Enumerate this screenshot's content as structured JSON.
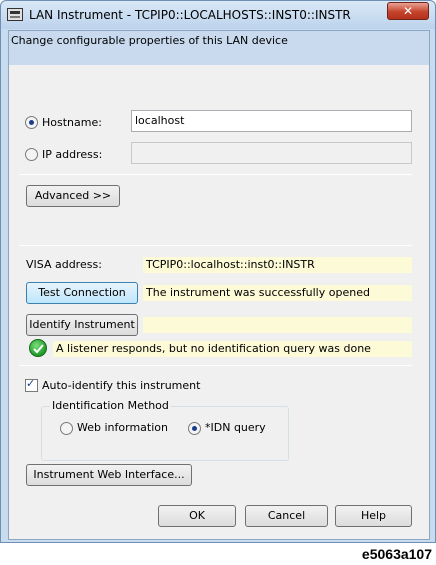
{
  "window": {
    "title": "LAN Instrument - TCPIP0::LOCALHOSTS::INST0::INSTR",
    "close_icon": "close-x-icon",
    "close_label": "✕"
  },
  "header": {
    "text": "Change configurable properties of this LAN device"
  },
  "address": {
    "hostname_label": "Hostname:",
    "hostname_value": "localhost",
    "hostname_selected": true,
    "ip_label": "IP address:",
    "ip_value": "",
    "ip_selected": false,
    "advanced_label": "Advanced >>"
  },
  "visa": {
    "label": "VISA address:",
    "value": "TCPIP0::localhost::inst0::INSTR"
  },
  "test": {
    "button_label": "Test Connection",
    "result": "The instrument was successfully opened"
  },
  "identify": {
    "button_label": "Identify Instrument",
    "result": "",
    "status_icon": "check-circle-icon",
    "status_text": "A listener responds, but no identification query was done"
  },
  "auto_identify": {
    "label": "Auto-identify this instrument",
    "checked": true
  },
  "identification_method": {
    "title": "Identification Method",
    "options": [
      {
        "label": "Web information",
        "selected": false
      },
      {
        "label": "*IDN query",
        "selected": true
      }
    ]
  },
  "web_interface_button": "Instrument Web Interface...",
  "footer_buttons": {
    "ok": "OK",
    "cancel": "Cancel",
    "help": "Help"
  },
  "figure_code": "e5063a107",
  "colors": {
    "header_band": "#c9daef",
    "result_field": "#fdfad7",
    "success_green": "#1f9a2a",
    "close_red": "#c5432c"
  }
}
